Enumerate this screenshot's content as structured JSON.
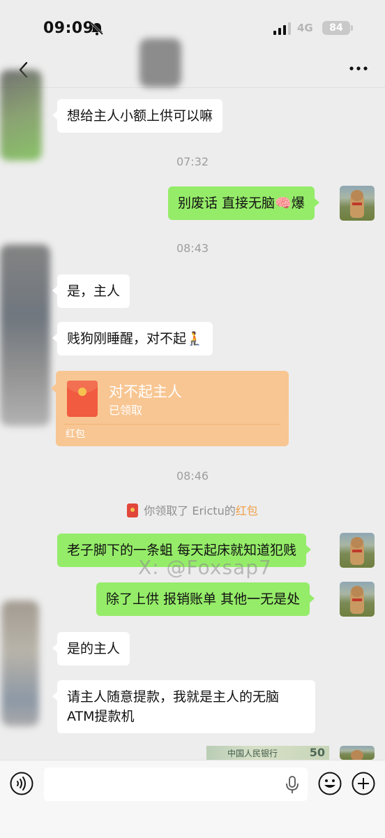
{
  "status_bar": {
    "time": "09:09",
    "network": "4G",
    "battery": "84"
  },
  "nav": {
    "back_icon": "back-chevron-icon",
    "more_icon": "more-dots-icon"
  },
  "messages": {
    "m1": "想给主人小额上供可以嘛",
    "t1": "07:32",
    "m2": "别废话 直接无脑🧠爆",
    "t2": "08:43",
    "m3": "是，主人",
    "m4": "贱狗刚睡醒，对不起🧎",
    "red_packet": {
      "title": "对不起主人",
      "status": "已领取",
      "label": "红包"
    },
    "t3": "08:46",
    "notice": {
      "prefix": "你领取了",
      "name": "Erictu",
      "mid": "的",
      "link": "红包"
    },
    "m5": "老子脚下的一条蛆 每天起床就知道犯贱",
    "m6": "除了上供 报销账单 其他一无是处",
    "m7": "是的主人",
    "m8": "请主人随意提款，我就是主人的无脑ATM提款机",
    "banknote_text": "中国人民银行",
    "banknote_value": "50"
  },
  "watermark": "X: @Foxsap7",
  "colors": {
    "sent_bubble": "#95ec69",
    "received_bubble": "#ffffff",
    "background": "#ededed",
    "red_packet": "#f8c693",
    "link": "#f0a04b"
  },
  "input_bar": {
    "voice_icon": "voice-icon",
    "mic_icon": "mic-icon",
    "emoji_icon": "emoji-icon",
    "plus_icon": "plus-icon"
  }
}
